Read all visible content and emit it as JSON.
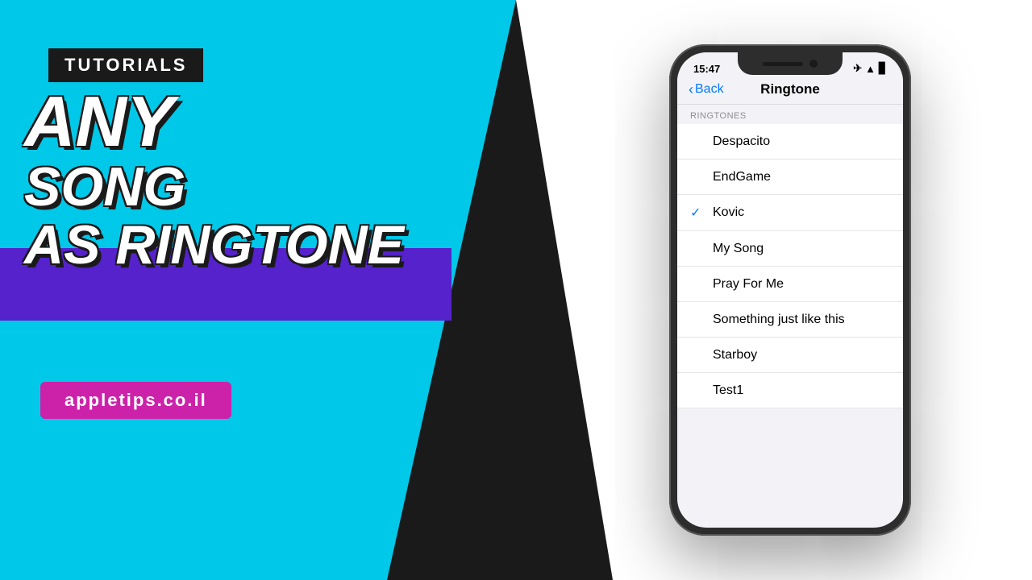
{
  "left": {
    "badge": "TUTORIALS",
    "title_line1": "ANY",
    "title_line2": "SONG",
    "title_line3": "AS RINGTONE",
    "website": "appletips.co.il"
  },
  "phone": {
    "status": {
      "time": "15:47",
      "icons": "✈ ▲ ▊"
    },
    "nav": {
      "back_label": "Back",
      "title": "Ringtone"
    },
    "section_header": "RINGTONES",
    "ringtones": [
      {
        "name": "Despacito",
        "selected": false
      },
      {
        "name": "EndGame",
        "selected": false
      },
      {
        "name": "Kovic",
        "selected": true
      },
      {
        "name": "My Song",
        "selected": false
      },
      {
        "name": "Pray For Me",
        "selected": false
      },
      {
        "name": "Something just like this",
        "selected": false
      },
      {
        "name": "Starboy",
        "selected": false
      },
      {
        "name": "Test1",
        "selected": false
      }
    ]
  },
  "colors": {
    "cyan_bg": "#00c8e8",
    "purple": "#5522cc",
    "pink": "#cc22aa",
    "ios_blue": "#007aff"
  }
}
